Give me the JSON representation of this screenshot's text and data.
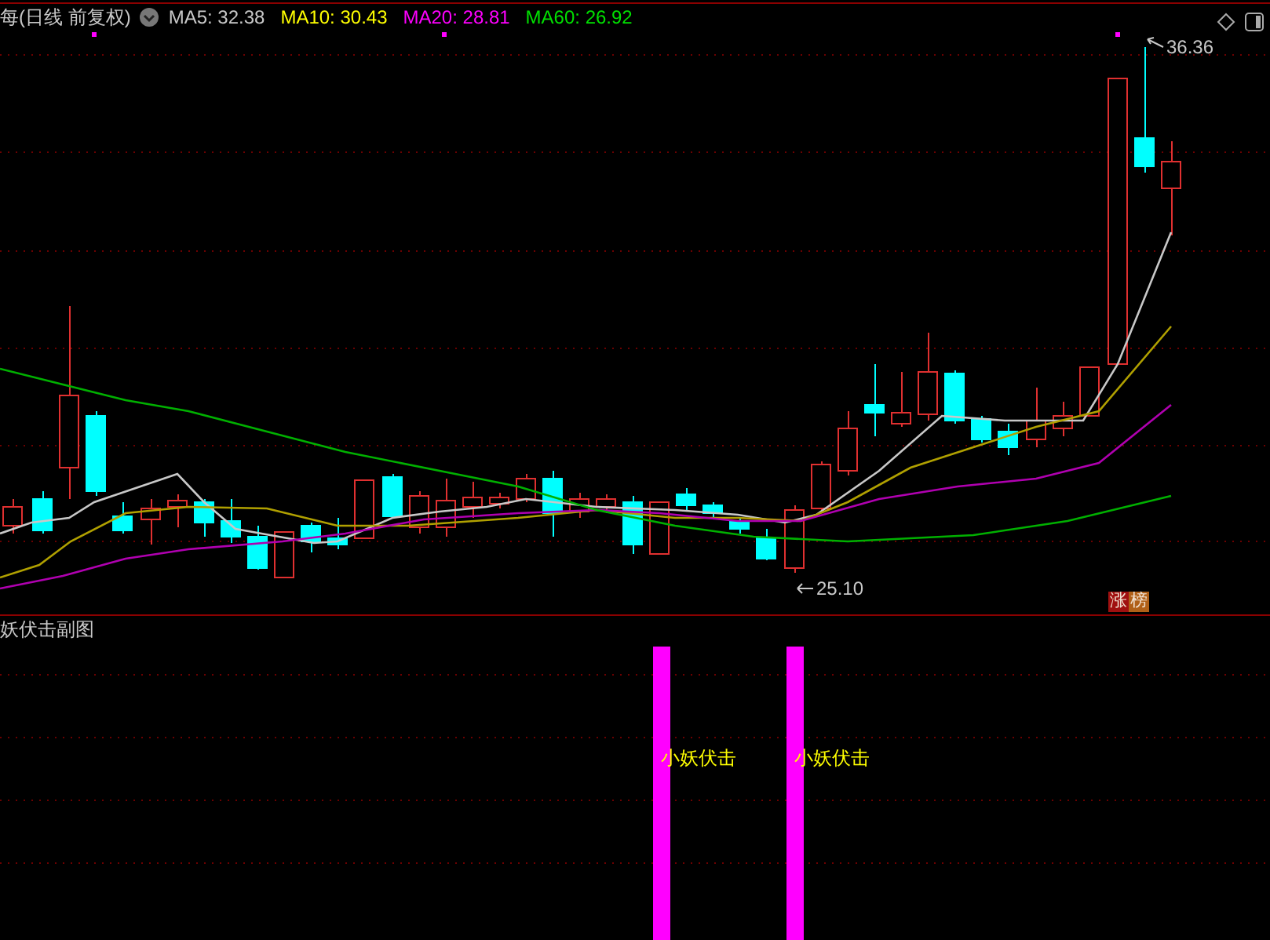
{
  "header": {
    "title": "每(日线 前复权)",
    "indicators": [
      {
        "label": "MA5: 32.38",
        "color": "#c8c8c8"
      },
      {
        "label": "MA10: 30.43",
        "color": "#ffff00"
      },
      {
        "label": "MA20: 28.81",
        "color": "#ff00ff"
      },
      {
        "label": "MA60: 26.92",
        "color": "#00e000"
      }
    ]
  },
  "price_chart": {
    "high_label": "36.36",
    "low_label": "25.10",
    "badge": [
      {
        "text": "涨",
        "color": "#a01010"
      },
      {
        "text": "榜",
        "color": "#b06018"
      }
    ]
  },
  "sub_chart": {
    "title": "妖伏击副图",
    "signals": [
      {
        "label": "小妖伏击"
      },
      {
        "label": "小妖伏击"
      }
    ]
  }
}
